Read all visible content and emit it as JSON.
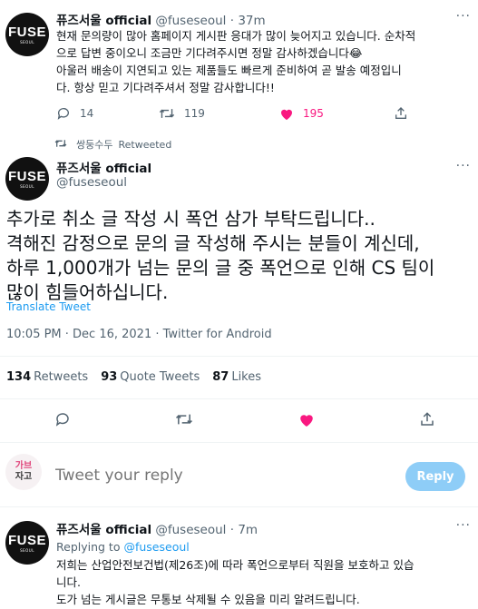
{
  "tweet1": {
    "avatar_text": "FUSE",
    "avatar_sub": "SEOUL",
    "name": "퓨즈서울 official",
    "handle": "@fuseseoul",
    "time": "· 37m",
    "lines": [
      "현재 문의량이 많아 홈페이지 게시판 응대가 많이 늦어지고 있습니다. 순차적",
      "으로 답변 중이오니 조금만 기다려주시면 정말 감사하겠습니다😂",
      " 아울러 배송이 지연되고 있는 제품들도 빠르게 준비하여 곧 발송 예정입니",
      "다. 항상 믿고 기다려주셔서 정말 감사합니다!!"
    ],
    "replies": "14",
    "retweets": "119",
    "likes": "195"
  },
  "retweet_label": {
    "user": "쌍둥수두",
    "text": "Retweeted"
  },
  "tweet2": {
    "avatar_text": "FUSE",
    "avatar_sub": "SEOUL",
    "name": "퓨즈서울 official",
    "handle": "@fuseseoul",
    "lines": [
      "추가로 취소 글 작성 시 폭언 삼가 부탁드립니다..",
      "격해진 감정으로 문의 글 작성해 주시는 분들이 계신데,",
      "하루 1,000개가 넘는 문의 글 중 폭언으로 인해 CS 팀이",
      "많이 힘들어하십니다."
    ],
    "translate": "Translate Tweet",
    "meta": "10:05 PM · Dec 16, 2021 · Twitter for Android",
    "retweets_count": "134",
    "retweets_label": "Retweets",
    "quotes_count": "93",
    "quotes_label": "Quote Tweets",
    "likes_count": "87",
    "likes_label": "Likes"
  },
  "composer": {
    "avatar_line1": "가브",
    "avatar_line2": "자고",
    "placeholder": "Tweet your reply",
    "button": "Reply"
  },
  "tweet3": {
    "avatar_text": "FUSE",
    "avatar_sub": "SEOUL",
    "name": "퓨즈서울 official",
    "handle": "@fuseseoul",
    "time": "· 7m",
    "replying_prefix": "Replying to",
    "replying_to": "@fuseseoul",
    "lines": [
      "저희는 산업안전보건법(제26조)에 따라 폭언으로부터 직원을 보호하고 있습",
      "니다.",
      "도가 넘는 게시글은 무통보 삭제될 수 있음을 미리 알려드립니다."
    ]
  },
  "colors": {
    "like_pink": "#f91880",
    "link_blue": "#1d9bf0",
    "muted": "#536471",
    "reply_button": "#8ecdf7"
  },
  "icons": [
    "reply-icon",
    "retweet-icon",
    "like-icon",
    "share-icon",
    "more-icon"
  ]
}
